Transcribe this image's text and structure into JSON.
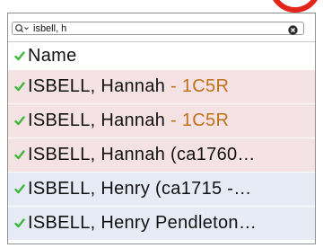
{
  "search": {
    "value": "isbell, h"
  },
  "header": {
    "label": "Name"
  },
  "rows": [
    {
      "name": "ISBELL, Hannah",
      "suffix": " - 1C5R",
      "tint": "pink"
    },
    {
      "name": "ISBELL, Hannah",
      "suffix": " - 1C5R",
      "tint": "pink"
    },
    {
      "name": "ISBELL, Hannah (ca1760…",
      "suffix": "",
      "tint": "pink"
    },
    {
      "name": "ISBELL, Henry (ca1715 -…",
      "suffix": "",
      "tint": "blue"
    },
    {
      "name": "ISBELL, Henry Pendleton…",
      "suffix": "",
      "tint": "blue"
    }
  ],
  "colors": {
    "check": "#3db83a",
    "suffix": "#c0711c",
    "pink_row": "#f5e2e4",
    "blue_row": "#e6ebf5",
    "accent_circle": "#e3241b"
  },
  "icons": {
    "search": "search-icon",
    "clear": "clear-icon",
    "check": "checkmark-icon"
  }
}
